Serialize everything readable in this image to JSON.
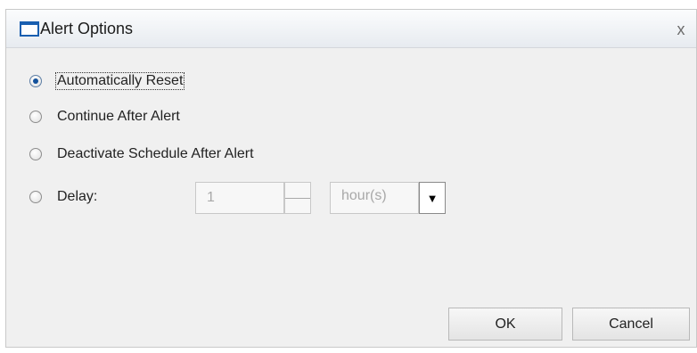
{
  "dialog": {
    "title": "Alert Options",
    "close_label": "x"
  },
  "options": [
    {
      "label": "Automatically Reset",
      "selected": true
    },
    {
      "label": "Continue After Alert",
      "selected": false
    },
    {
      "label": "Deactivate Schedule After Alert",
      "selected": false
    },
    {
      "label": "Delay:",
      "selected": false
    }
  ],
  "delay": {
    "value": "1",
    "unit": "hour(s)",
    "arrow": "▼"
  },
  "buttons": {
    "ok": "OK",
    "cancel": "Cancel"
  },
  "colors": {
    "accent": "#13519b",
    "dialog_bg": "#f0f0f0"
  },
  "icons": {
    "title": "window-icon",
    "close": "close-icon",
    "dropdown": "dropdown-arrow-icon"
  }
}
